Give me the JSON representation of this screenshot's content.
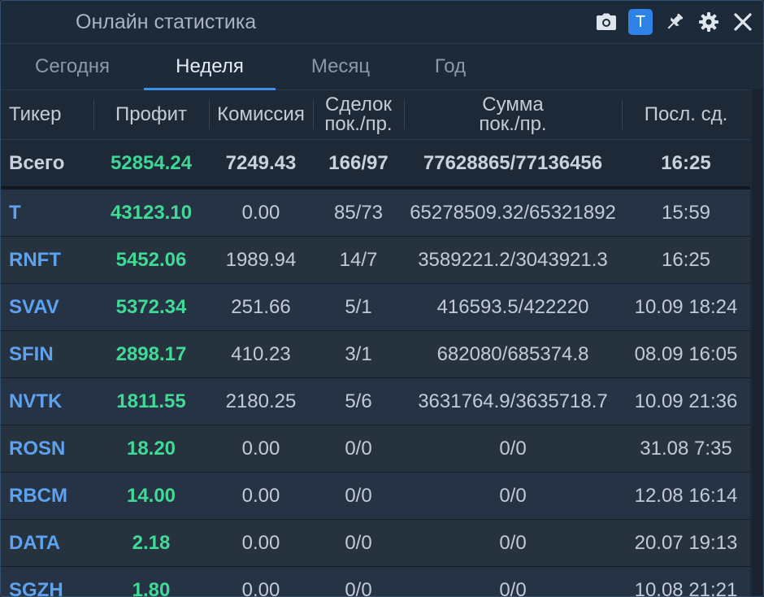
{
  "window": {
    "title": "Онлайн статистика"
  },
  "toolbar": {
    "active_label": "T"
  },
  "tabs": [
    {
      "label": "Сегодня"
    },
    {
      "label": "Неделя"
    },
    {
      "label": "Месяц"
    },
    {
      "label": "Год"
    }
  ],
  "active_tab": "Неделя",
  "columns": {
    "ticker": "Тикер",
    "profit": "Профит",
    "commission": "Комиссия",
    "trades_1": "Сделок",
    "trades_2": "пок./пр.",
    "sum_1": "Сумма",
    "sum_2": "пок./пр.",
    "last": "Посл. сд."
  },
  "total": {
    "ticker": "Всего",
    "profit": "52854.24",
    "commission": "7249.43",
    "trades": "166/97",
    "sum": "77628865/77136456",
    "last": "16:25"
  },
  "rows": [
    {
      "ticker": "T",
      "profit": "43123.10",
      "commission": "0.00",
      "trades": "85/73",
      "sum": "65278509.32/65321892",
      "last": "15:59"
    },
    {
      "ticker": "RNFT",
      "profit": "5452.06",
      "commission": "1989.94",
      "trades": "14/7",
      "sum": "3589221.2/3043921.3",
      "last": "16:25"
    },
    {
      "ticker": "SVAV",
      "profit": "5372.34",
      "commission": "251.66",
      "trades": "5/1",
      "sum": "416593.5/422220",
      "last": "10.09 18:24"
    },
    {
      "ticker": "SFIN",
      "profit": "2898.17",
      "commission": "410.23",
      "trades": "3/1",
      "sum": "682080/685374.8",
      "last": "08.09 16:05"
    },
    {
      "ticker": "NVTK",
      "profit": "1811.55",
      "commission": "2180.25",
      "trades": "5/6",
      "sum": "3631764.9/3635718.7",
      "last": "10.09 21:36"
    },
    {
      "ticker": "ROSN",
      "profit": "18.20",
      "commission": "0.00",
      "trades": "0/0",
      "sum": "0/0",
      "last": "31.08 7:35"
    },
    {
      "ticker": "RBCM",
      "profit": "14.00",
      "commission": "0.00",
      "trades": "0/0",
      "sum": "0/0",
      "last": "12.08 16:14"
    },
    {
      "ticker": "DATA",
      "profit": "2.18",
      "commission": "0.00",
      "trades": "0/0",
      "sum": "0/0",
      "last": "20.07 19:13"
    },
    {
      "ticker": "SGZH",
      "profit": "1.80",
      "commission": "0.00",
      "trades": "0/0",
      "sum": "0/0",
      "last": "10.08 21:21"
    }
  ],
  "colors": {
    "accent": "#2f82e6",
    "profit": "#41d996",
    "ticker": "#5ea2ef"
  },
  "icons": [
    "camera-icon",
    "pin-icon",
    "gear-icon",
    "close-icon"
  ]
}
